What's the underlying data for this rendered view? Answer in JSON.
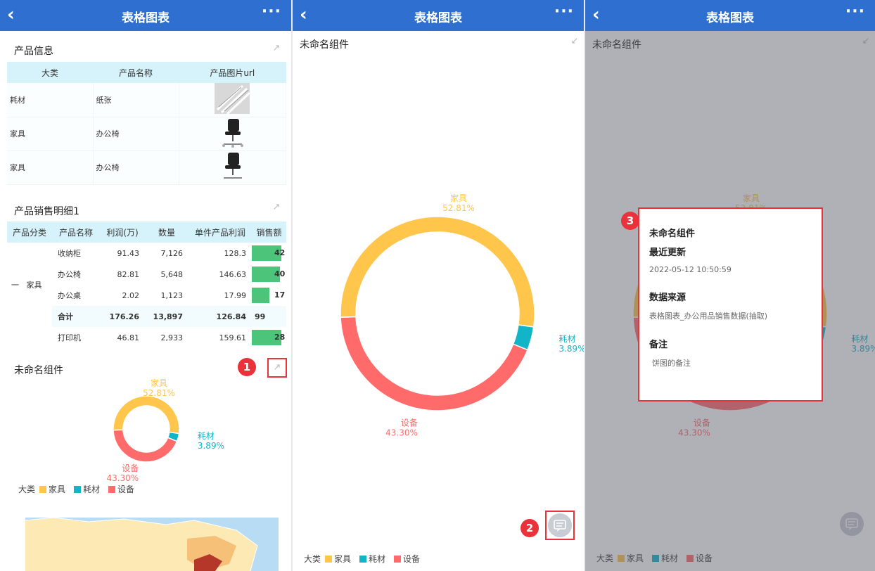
{
  "header": {
    "back_icon": "chevron-left-icon",
    "title": "表格图表",
    "more_icon": "more-icon"
  },
  "panel1": {
    "product_info": {
      "title": "产品信息",
      "columns": [
        "大类",
        "产品名称",
        "产品图片url"
      ],
      "rows": [
        {
          "category": "耗材",
          "name": "纸张",
          "image": "paper-image"
        },
        {
          "category": "家具",
          "name": "办公椅",
          "image": "office-chair-image"
        },
        {
          "category": "家具",
          "name": "办公椅",
          "image": "office-chair-image"
        }
      ]
    },
    "sales_detail": {
      "title": "产品销售明细1",
      "columns": [
        "产品分类",
        "产品名称",
        "利润(万)",
        "数量",
        "单件产品利润",
        "销售额"
      ],
      "group_label": "一",
      "group_name": "家具",
      "rows": [
        {
          "name": "收纳柜",
          "profit": "91.43",
          "qty": "7,126",
          "unit": "128.3",
          "sales": "42",
          "fill": 1.0
        },
        {
          "name": "办公椅",
          "profit": "82.81",
          "qty": "5,648",
          "unit": "146.63",
          "sales": "40",
          "fill": 0.95
        },
        {
          "name": "办公桌",
          "profit": "2.02",
          "qty": "1,123",
          "unit": "17.99",
          "sales": "17",
          "fill": 0.6
        }
      ],
      "total": {
        "name": "合计",
        "profit": "176.26",
        "qty": "13,897",
        "unit": "126.84",
        "sales": "99"
      },
      "extra_row": {
        "name": "打印机",
        "profit": "46.81",
        "qty": "2,933",
        "unit": "159.61",
        "sales": "28",
        "fill": 1.0
      }
    },
    "component_title": "未命名组件",
    "marker": "1"
  },
  "panel2": {
    "component_title": "未命名组件",
    "marker": "2"
  },
  "panel3": {
    "component_title": "未命名组件",
    "marker": "3",
    "popup": {
      "title": "未命名组件",
      "updated_label": "最近更新",
      "updated_value": "2022-05-12 10:50:59",
      "source_label": "数据来源",
      "source_value": "表格图表_办公用品销售数据(抽取)",
      "note_label": "备注",
      "note_value": "饼图的备注"
    }
  },
  "chart_data": {
    "type": "pie",
    "categories": [
      "家具",
      "耗材",
      "设备"
    ],
    "values": [
      52.81,
      3.89,
      43.3
    ],
    "labels": [
      "52.81%",
      "3.89%",
      "43.30%"
    ],
    "colors": [
      "#ffc64b",
      "#12b5c8",
      "#ff6b6b"
    ],
    "legend_title": "大类",
    "legend_position": "bottom-left"
  },
  "colors": {
    "header": "#2f6fd0",
    "marker": "#e9323a",
    "bar": "#4cc47a"
  }
}
